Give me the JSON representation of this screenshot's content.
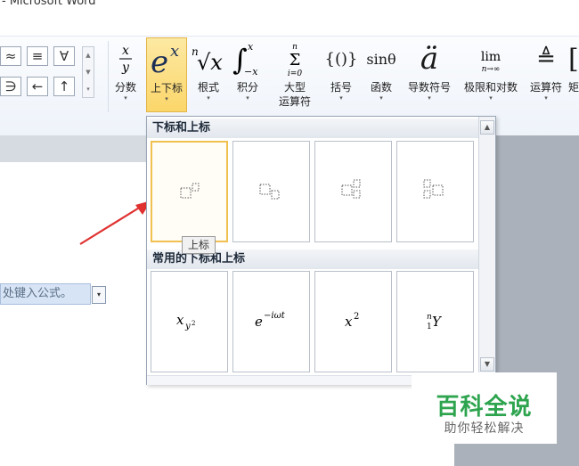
{
  "window": {
    "title": "- Microsoft Word"
  },
  "symbols": {
    "row1": [
      "≈",
      "≡",
      "∀"
    ],
    "row2": [
      "∋",
      "←",
      "↑"
    ],
    "scroll_up": "▲",
    "scroll_down": "▼",
    "scroll_more": "▾"
  },
  "ribbon": {
    "buttons": [
      {
        "id": "fraction",
        "label": "分数",
        "glyph": "x/y"
      },
      {
        "id": "script",
        "label": "上下标",
        "glyph": "e^x"
      },
      {
        "id": "radical",
        "label": "根式",
        "glyph": "ⁿ√x"
      },
      {
        "id": "integral",
        "label": "积分",
        "glyph": "∫"
      },
      {
        "id": "large-operator",
        "label": "大型",
        "label2": "运算符",
        "glyph": "Σ"
      },
      {
        "id": "bracket",
        "label": "括号",
        "glyph": "{()}"
      },
      {
        "id": "function",
        "label": "函数",
        "glyph": "sinθ"
      },
      {
        "id": "accent",
        "label": "导数符号",
        "glyph": "ä"
      },
      {
        "id": "limit-log",
        "label": "极限和对数",
        "glyph": "lim"
      },
      {
        "id": "operator",
        "label": "运算符",
        "glyph": "≜"
      },
      {
        "id": "matrix",
        "label": "矩",
        "glyph": "["
      }
    ],
    "dropdown_arrow": "▾",
    "fraction_glyph_top": "x",
    "fraction_glyph_bottom": "y",
    "script_glyph_base": "e",
    "script_glyph_sup": "x",
    "radical_glyph_index": "n",
    "radical_glyph_body": "√x",
    "integral_glyph": "∫",
    "integral_upper": "x",
    "integral_lower": "−x",
    "sum_upper": "n",
    "sum_symbol": "Σ",
    "sum_lower": "i=0",
    "bracket_glyph": "{()}",
    "function_glyph": "sinθ",
    "accent_glyph": "ä",
    "limit_glyph": "lim",
    "limit_sub": "n→∞",
    "operator_glyph": "≜",
    "matrix_glyph": "["
  },
  "gallery": {
    "section1_title": "下标和上标",
    "section2_title": "常用的下标和上标",
    "tiles_row1": [
      "superscript",
      "subscript",
      "subscript-superscript",
      "left-subscript-superscript"
    ],
    "tiles_row2": [
      {
        "base": "x",
        "sub": "y",
        "subsup": "2"
      },
      {
        "base": "e",
        "sup": "−iωt"
      },
      {
        "base": "x",
        "sup": "2"
      },
      {
        "pre_sup": "n",
        "pre_sub": "1",
        "base": "Y"
      }
    ],
    "tooltip": "上标"
  },
  "document": {
    "formula_placeholder": "处键入公式。",
    "formula_dropdown": "▾"
  },
  "watermark": {
    "title": "百科全说",
    "subtitle": "助你轻松解决"
  },
  "colors": {
    "active_button": "#fbd66a",
    "hover_tile_border": "#f0c050",
    "arrow": "#e03030",
    "watermark_green": "#2ea44f"
  }
}
